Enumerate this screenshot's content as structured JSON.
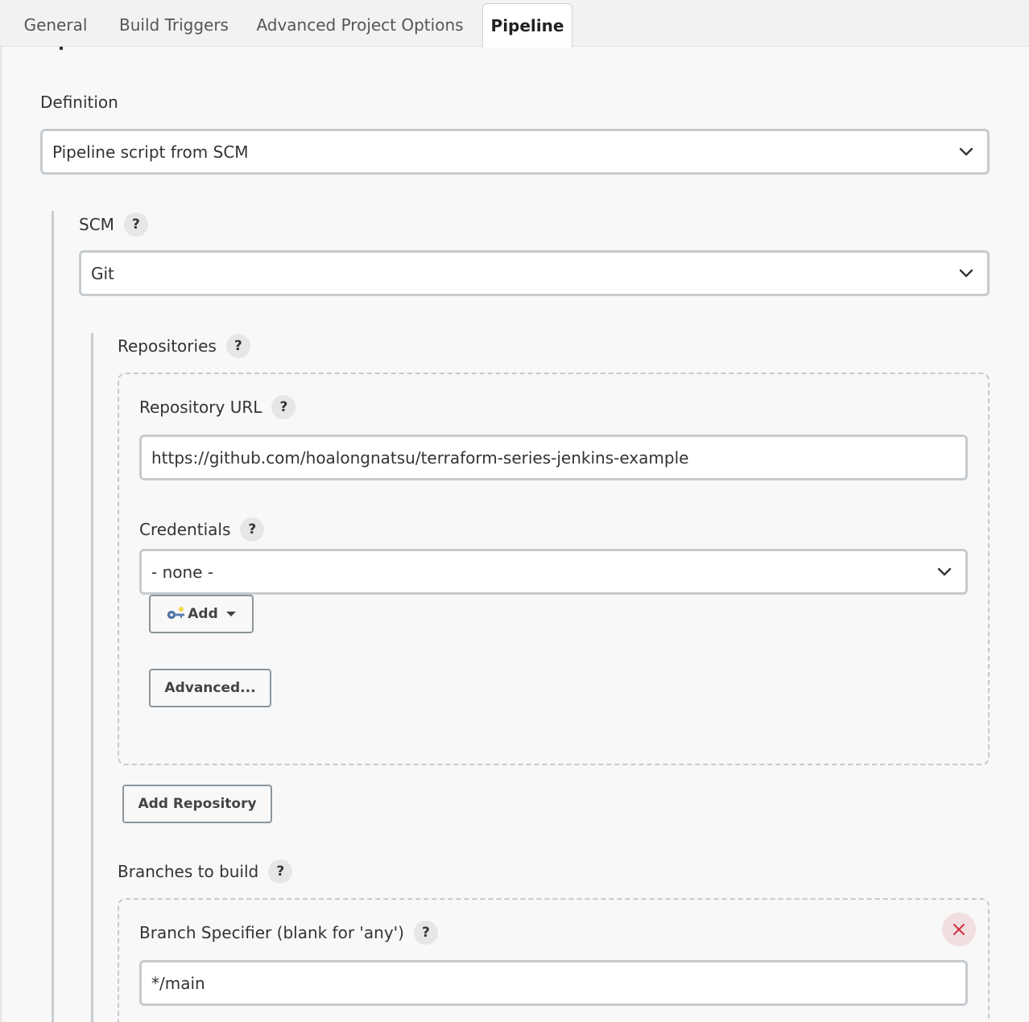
{
  "tabs": [
    {
      "label": "General",
      "active": false
    },
    {
      "label": "Build Triggers",
      "active": false
    },
    {
      "label": "Advanced Project Options",
      "active": false
    },
    {
      "label": "Pipeline",
      "active": true
    }
  ],
  "definition": {
    "label": "Definition",
    "value": "Pipeline script from SCM"
  },
  "scm": {
    "label": "SCM",
    "help": "?",
    "value": "Git"
  },
  "repositories": {
    "label": "Repositories",
    "help": "?",
    "url_label": "Repository URL",
    "url_help": "?",
    "url_value": "https://github.com/hoalongnatsu/terraform-series-jenkins-example",
    "credentials_label": "Credentials",
    "credentials_help": "?",
    "credentials_value": "- none -",
    "add_label": "Add",
    "advanced_label": "Advanced...",
    "add_repository_label": "Add Repository"
  },
  "branches": {
    "label": "Branches to build",
    "help": "?",
    "specifier_label": "Branch Specifier (blank for 'any')",
    "specifier_help": "?",
    "specifier_value": "*/main",
    "remove_symbol": "✕"
  },
  "icons": {
    "chevron": "chevron-down-icon",
    "key": "key-icon",
    "close": "close-icon"
  },
  "colors": {
    "remove_accent": "#d33040",
    "field_border": "#c6cbcf"
  }
}
